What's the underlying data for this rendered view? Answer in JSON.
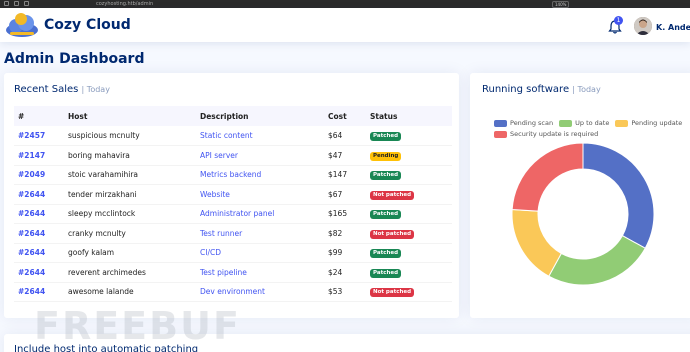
{
  "browser": {
    "url": "cozyhosting.htb/admin",
    "zoom": "140%"
  },
  "header": {
    "brand": "Cozy Cloud",
    "notifications_count": "1",
    "username": "K. Anderson"
  },
  "page_title": "Admin Dashboard",
  "recent_sales": {
    "title": "Recent Sales",
    "subtitle": "| Today",
    "columns": [
      "#",
      "Host",
      "Description",
      "Cost",
      "Status"
    ],
    "rows": [
      {
        "id": "#2457",
        "host": "suspicious mcnulty",
        "description": "Static content",
        "cost": "$64",
        "status": "Patched",
        "status_type": "patched"
      },
      {
        "id": "#2147",
        "host": "boring mahavira",
        "description": "API server",
        "cost": "$47",
        "status": "Pending",
        "status_type": "pending"
      },
      {
        "id": "#2049",
        "host": "stoic varahamihira",
        "description": "Metrics backend",
        "cost": "$147",
        "status": "Patched",
        "status_type": "patched"
      },
      {
        "id": "#2644",
        "host": "tender mirzakhani",
        "description": "Website",
        "cost": "$67",
        "status": "Not patched",
        "status_type": "notpatched"
      },
      {
        "id": "#2644",
        "host": "sleepy mcclintock",
        "description": "Administrator panel",
        "cost": "$165",
        "status": "Patched",
        "status_type": "patched"
      },
      {
        "id": "#2644",
        "host": "cranky mcnulty",
        "description": "Test runner",
        "cost": "$82",
        "status": "Not patched",
        "status_type": "notpatched"
      },
      {
        "id": "#2644",
        "host": "goofy kalam",
        "description": "CI/CD",
        "cost": "$99",
        "status": "Patched",
        "status_type": "patched"
      },
      {
        "id": "#2644",
        "host": "reverent archimedes",
        "description": "Test pipeline",
        "cost": "$24",
        "status": "Patched",
        "status_type": "patched"
      },
      {
        "id": "#2644",
        "host": "awesome lalande",
        "description": "Dev environment",
        "cost": "$53",
        "status": "Not patched",
        "status_type": "notpatched"
      }
    ]
  },
  "running_software": {
    "title": "Running software",
    "subtitle": "| Today"
  },
  "chart_data": {
    "type": "pie",
    "categories": [
      "Pending scan",
      "Up to date",
      "Pending update",
      "Security update is required"
    ],
    "values": [
      33,
      25,
      18,
      24
    ],
    "colors": [
      "#5470c6",
      "#91cc75",
      "#fac858",
      "#ee6666"
    ],
    "legend_position": "top",
    "donut": true
  },
  "bottom_card": {
    "title": "Include host into automatic patching"
  },
  "watermark": "FREEBUF",
  "colors": {
    "brand": "#012970",
    "accent": "#4154f1",
    "background": "#f6f9ff"
  }
}
